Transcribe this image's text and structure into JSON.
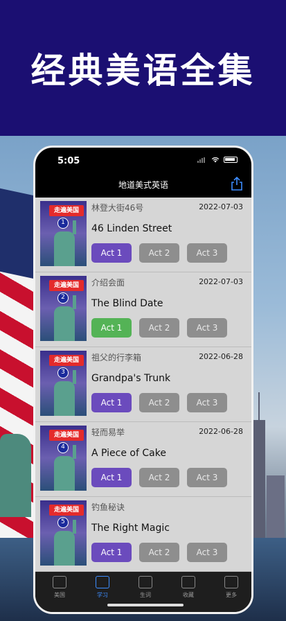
{
  "banner": {
    "title": "经典美语全集"
  },
  "status": {
    "time": "5:05"
  },
  "nav": {
    "title": "地道美式英语"
  },
  "lessons": [
    {
      "num": "1",
      "cn": "林登大街46号",
      "date": "2022-07-03",
      "en": "46 Linden Street",
      "acts": [
        "Act 1",
        "Act 2",
        "Act 3"
      ],
      "selected": 0,
      "selected_color": "#6b4bbd"
    },
    {
      "num": "2",
      "cn": "介绍会面",
      "date": "2022-07-03",
      "en": "The Blind Date",
      "acts": [
        "Act 1",
        "Act 2",
        "Act 3"
      ],
      "selected": 0,
      "selected_color": "#54b356"
    },
    {
      "num": "3",
      "cn": "祖父的行李箱",
      "date": "2022-06-28",
      "en": "Grandpa's Trunk",
      "acts": [
        "Act 1",
        "Act 2",
        "Act 3"
      ],
      "selected": 0,
      "selected_color": "#6b4bbd"
    },
    {
      "num": "4",
      "cn": "轻而易举",
      "date": "2022-06-28",
      "en": "A Piece of Cake",
      "acts": [
        "Act 1",
        "Act 2",
        "Act 3"
      ],
      "selected": 0,
      "selected_color": "#6b4bbd"
    },
    {
      "num": "5",
      "cn": "钓鱼秘诀",
      "date": "",
      "en": "The Right Magic",
      "acts": [
        "Act 1",
        "Act 2",
        "Act 3"
      ],
      "selected": 0,
      "selected_color": "#6b4bbd"
    }
  ],
  "poster_logo": "走遍美国",
  "tabs": [
    {
      "label": "美国",
      "icon": "flag-icon"
    },
    {
      "label": "学习",
      "icon": "audio-book-icon",
      "active": true
    },
    {
      "label": "生词",
      "icon": "clipboard-icon"
    },
    {
      "label": "收藏",
      "icon": "star-icon"
    },
    {
      "label": "更多",
      "icon": "more-icon"
    }
  ],
  "colors": {
    "banner": "#1b0f72",
    "accent": "#3d8dff",
    "act_selected": "#6b4bbd",
    "act_green": "#54b356"
  }
}
